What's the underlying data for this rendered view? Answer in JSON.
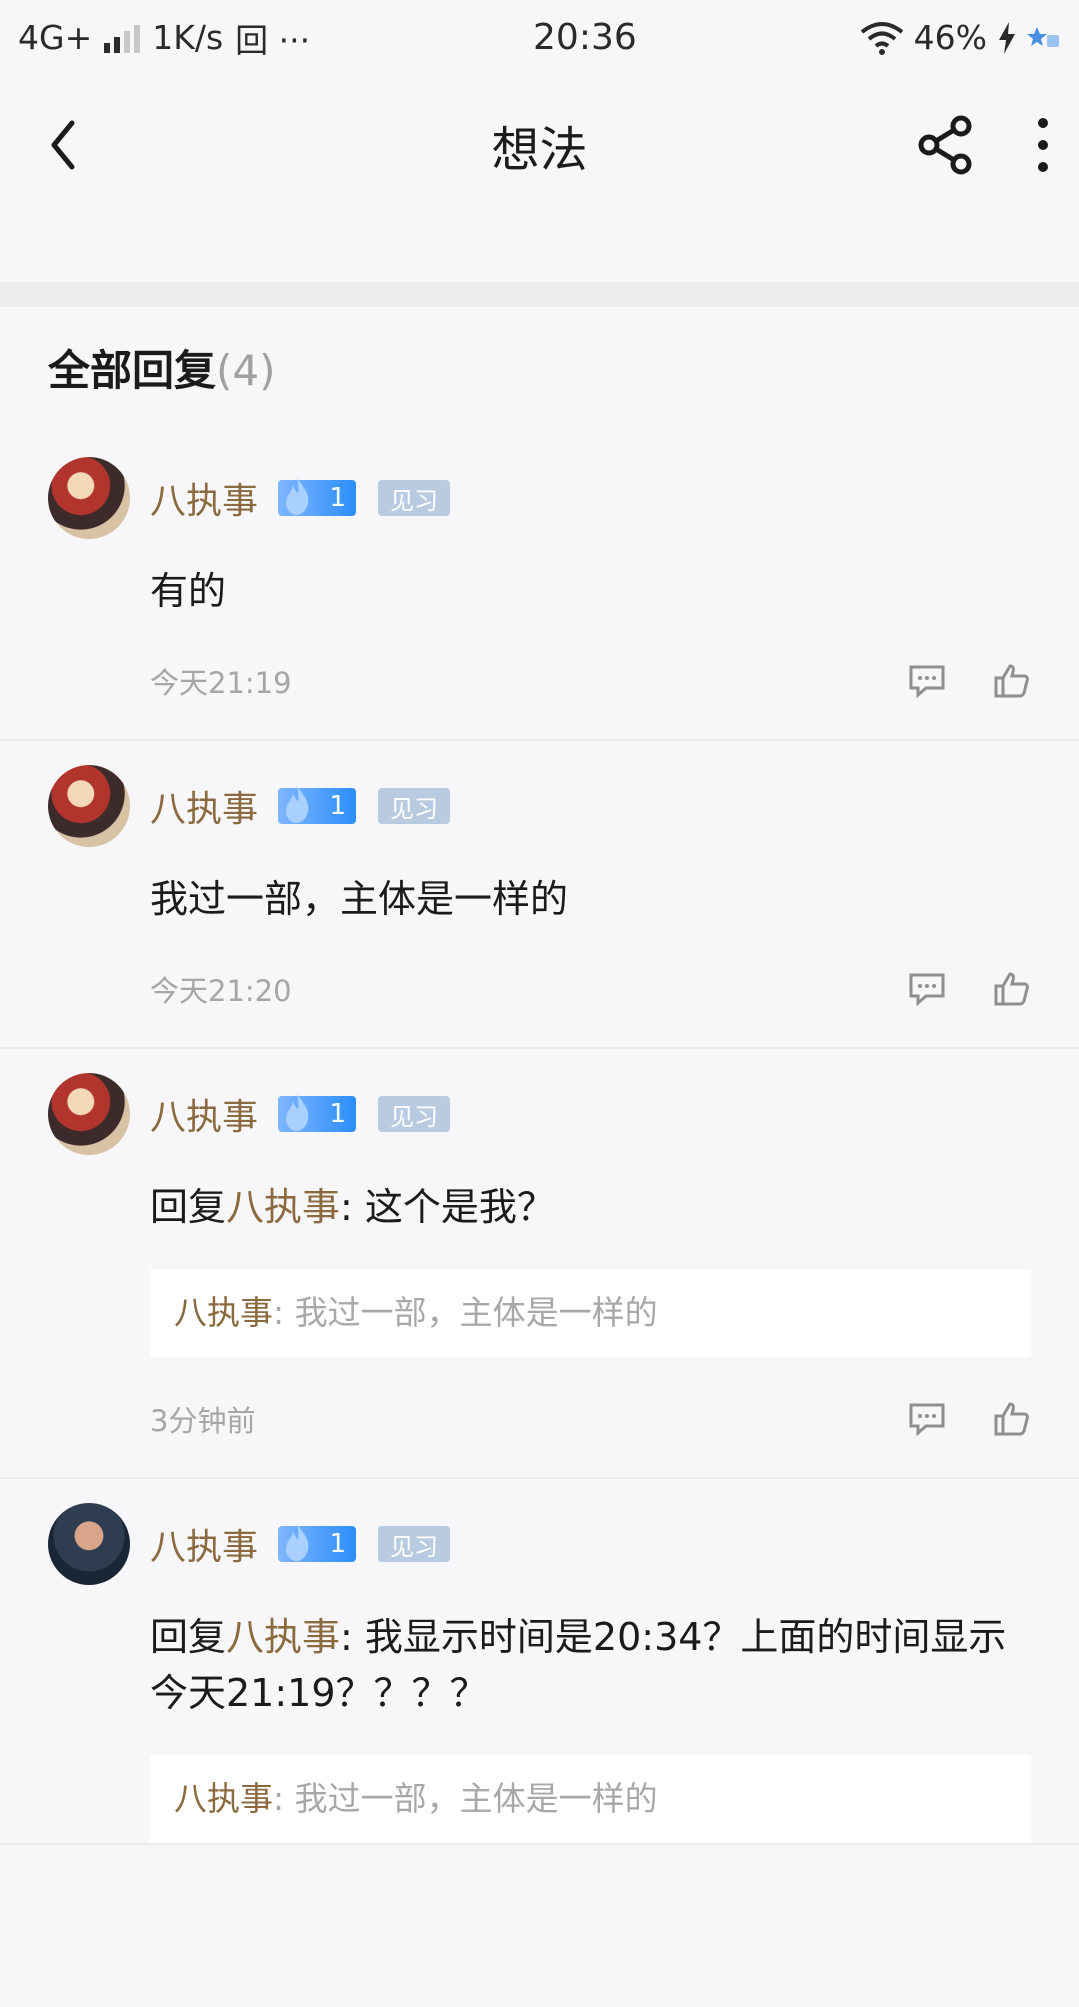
{
  "status": {
    "network": "4G+",
    "speed": "1K/s",
    "extra": "回 ···",
    "time": "20:36",
    "battery": "46%"
  },
  "nav": {
    "title": "想法"
  },
  "section": {
    "title": "全部回复",
    "count": "(4)"
  },
  "comments": [
    {
      "user": "八执事",
      "level": "1",
      "rank": "见习",
      "text": "有的",
      "time": "今天21:19"
    },
    {
      "user": "八执事",
      "level": "1",
      "rank": "见习",
      "text": "我过一部，主体是一样的",
      "time": "今天21:20"
    },
    {
      "user": "八执事",
      "level": "1",
      "rank": "见习",
      "reply_prefix": "回复",
      "reply_to": "八执事",
      "text": ": 这个是我？",
      "quote_user": "八执事",
      "quote_text": ": 我过一部，主体是一样的",
      "time": "3分钟前"
    },
    {
      "user": "八执事",
      "level": "1",
      "rank": "见习",
      "reply_prefix": "回复",
      "reply_to": "八执事",
      "text": ": 我显示时间是20:34？上面的时间显示今天21:19？？？？",
      "quote_user": "八执事",
      "quote_text": ": 我过一部，主体是一样的"
    }
  ],
  "colors": {
    "username": "#8a6a3e",
    "level_badge": "#2b8ef8",
    "rank_badge": "#b9cbe0"
  },
  "icons": [
    "back-icon",
    "share-icon",
    "more-icon",
    "comment-icon",
    "thumbs-up-icon",
    "wifi-icon",
    "charging-icon"
  ]
}
